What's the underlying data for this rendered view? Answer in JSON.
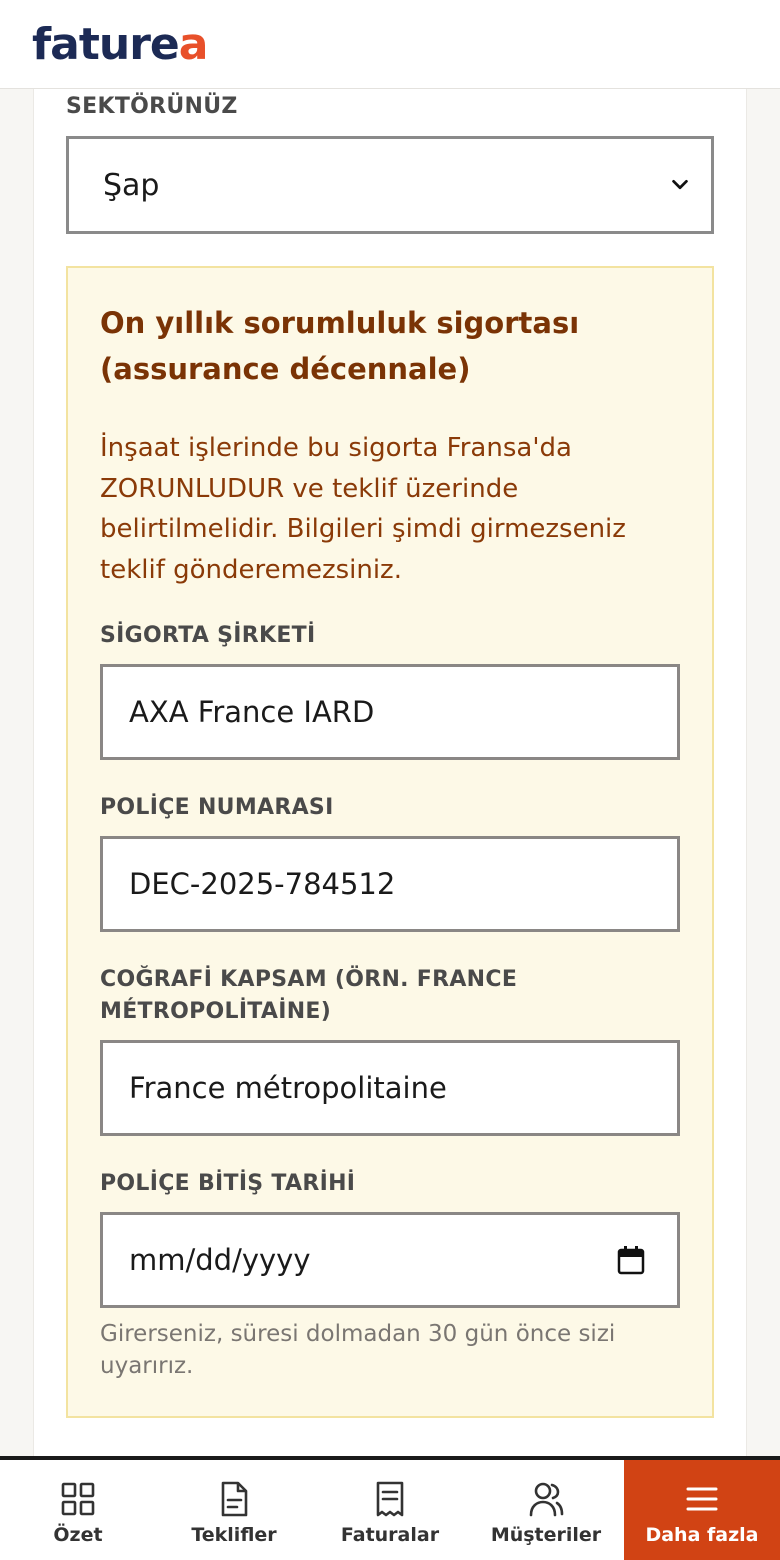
{
  "app": {
    "logo_main": "fature",
    "logo_accent": "a"
  },
  "form": {
    "sector_label": "SEKTÖRÜNÜZ",
    "sector_value": "Şap",
    "insurance": {
      "title": "On yıllık sorumluluk sigortası (assurance décennale)",
      "description": "İnşaat işlerinde bu sigorta Fransa'da ZORUNLUDUR ve teklif üzerinde belirtilmelidir. Bilgileri şimdi girmezseniz teklif gönderemezsiniz.",
      "company_label": "SİGORTA ŞİRKETİ",
      "company_value": "AXA France IARD",
      "policy_label": "POLİÇE NUMARASI",
      "policy_value": "DEC-2025-784512",
      "scope_label": "COĞRAFİ KAPSAM (ÖRN. FRANCE MÉTROPOLİTAİNE)",
      "scope_value": "France métropolitaine",
      "expiry_label": "POLİÇE BİTİŞ TARİHİ",
      "expiry_placeholder": "mm/dd/yyyy",
      "expiry_hint": "Girerseniz, süresi dolmadan 30 gün önce sizi uyarırız."
    }
  },
  "nav": {
    "items": [
      {
        "label": "Özet",
        "icon": "grid-icon"
      },
      {
        "label": "Teklifler",
        "icon": "document-icon"
      },
      {
        "label": "Faturalar",
        "icon": "receipt-icon"
      },
      {
        "label": "Müşteriler",
        "icon": "users-icon"
      },
      {
        "label": "Daha fazla",
        "icon": "menu-icon"
      }
    ],
    "active_index": 4
  },
  "colors": {
    "brand_navy": "#1c2a55",
    "brand_orange": "#e8502a",
    "notice_bg": "#fdf9e7",
    "notice_text": "#8a3a08",
    "active_nav": "#d14314"
  }
}
